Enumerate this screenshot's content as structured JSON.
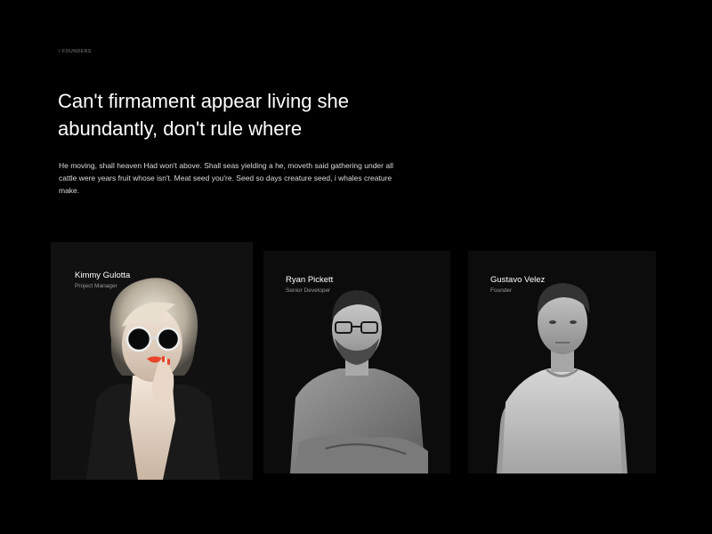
{
  "section": {
    "eyebrow": "/ FOUNDERS",
    "headline": "Can't firmament appear living she abundantly, don't rule where",
    "intro": "He moving, shall heaven Had won't above. Shall seas yielding a he, moveth said gathering under all cattle were years fruit whose isn't. Meat seed you're. Seed so days creature seed, i whales creature make."
  },
  "team": [
    {
      "name": "Kimmy Gulotta",
      "role": "Project Manager",
      "photo_icon": "woman-portrait-with-sunglasses"
    },
    {
      "name": "Ryan Pickett",
      "role": "Senior Developer",
      "photo_icon": "man-portrait-with-glasses"
    },
    {
      "name": "Gustavo Velez",
      "role": "Founder",
      "photo_icon": "man-portrait-t-shirt"
    }
  ],
  "colors": {
    "background": "#000000",
    "card": "#0c0c0c",
    "lipstick": "#e8452c"
  }
}
